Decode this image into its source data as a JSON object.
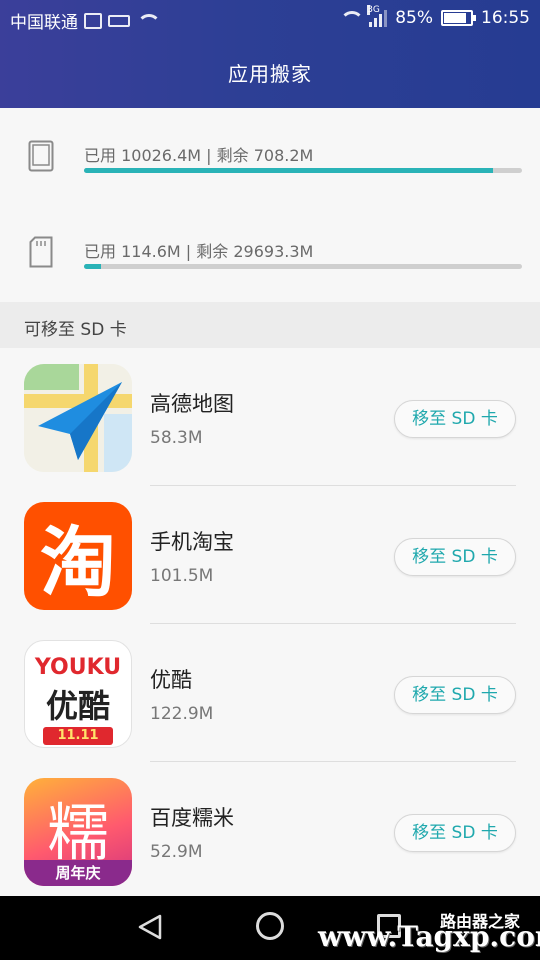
{
  "status_bar": {
    "carrier": "中国联通",
    "network_type": "3G",
    "battery_percent": "85%",
    "battery_level": 0.85,
    "time": "16:55"
  },
  "header": {
    "title": "应用搬家"
  },
  "storage": {
    "internal": {
      "text": "已用 10026.4M | 剩余 708.2M",
      "used_fraction": 0.934
    },
    "sd": {
      "text": "已用 114.6M | 剩余 29693.3M",
      "used_fraction": 0.039
    }
  },
  "section": {
    "label": "可移至 SD 卡"
  },
  "apps": [
    {
      "name": "高德地图",
      "size": "58.3M",
      "button": "移至 SD 卡",
      "icon": "amap-icon"
    },
    {
      "name": "手机淘宝",
      "size": "101.5M",
      "button": "移至 SD 卡",
      "icon": "taobao-icon"
    },
    {
      "name": "优酷",
      "size": "122.9M",
      "button": "移至 SD 卡",
      "icon": "youku-icon"
    },
    {
      "name": "百度糯米",
      "size": "52.9M",
      "button": "移至 SD 卡",
      "icon": "baidu-nuomi-icon"
    }
  ],
  "icon_text": {
    "taobao": "淘",
    "youku_logo": "YOUKU",
    "youku_cn": "优酷",
    "youku_badge": "11.11",
    "nuomi": "糯",
    "nuomi_badge": "周年庆"
  },
  "watermark": {
    "main": "www.Tagxp.com",
    "small": "路由器之家"
  },
  "colors": {
    "header": "#2d3f95",
    "accent": "#2ab3b7",
    "button_text": "#1fa8ad"
  }
}
